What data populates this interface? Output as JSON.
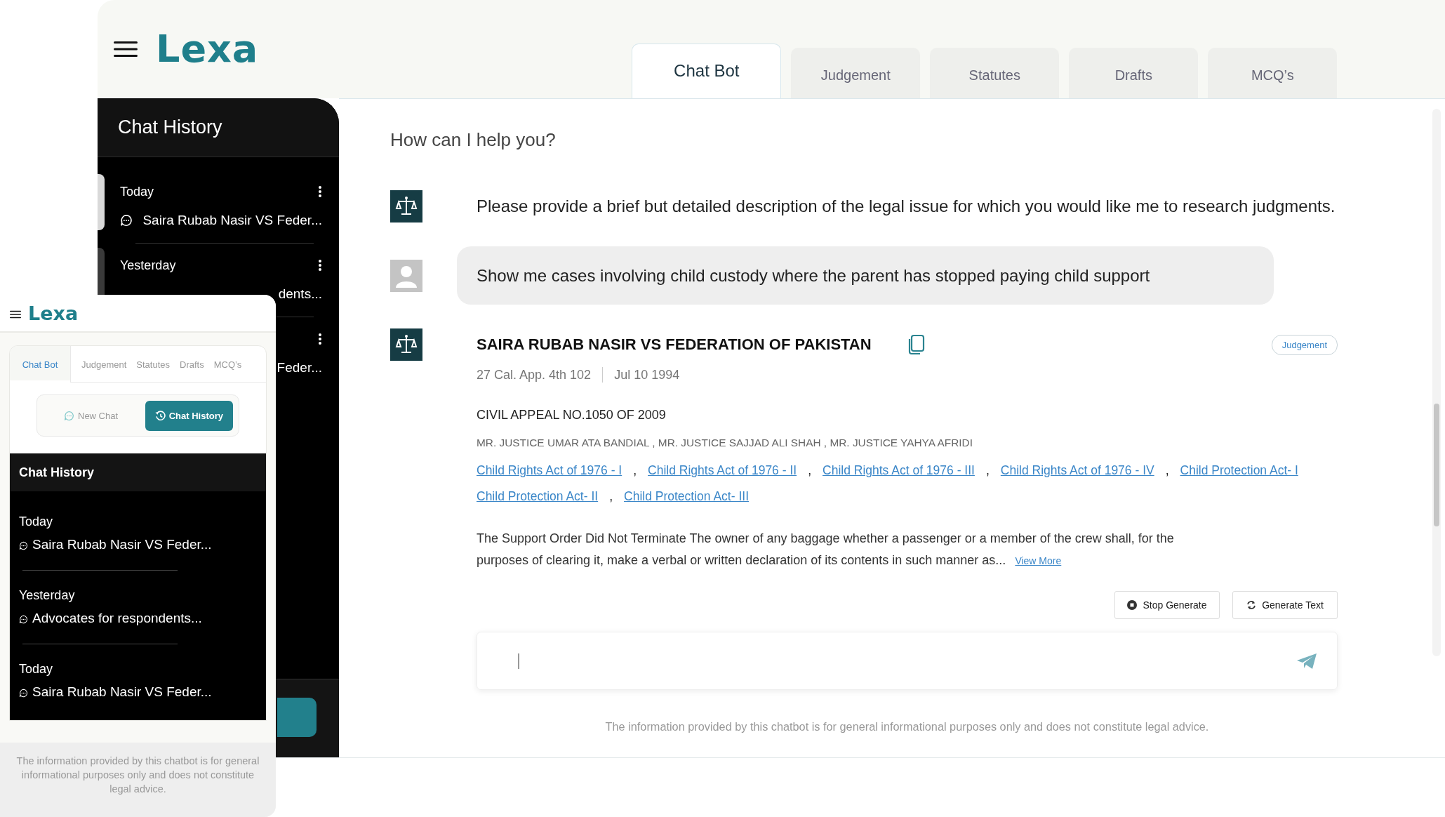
{
  "header": {
    "logo": "Lexa"
  },
  "tabs": [
    {
      "label": "Chat Bot",
      "selected": true
    },
    {
      "label": "Judgement",
      "selected": false
    },
    {
      "label": "Statutes",
      "selected": false
    },
    {
      "label": "Drafts",
      "selected": false
    },
    {
      "label": "MCQ’s",
      "selected": false
    }
  ],
  "sidebar": {
    "title": "Chat History",
    "items": [
      {
        "date": "Today",
        "title": "Saira Rubab Nasir VS Feder...",
        "icon": true,
        "selected": true
      },
      {
        "date": "Yesterday",
        "title": "dents...",
        "icon": false,
        "selected": false
      },
      {
        "title": "Feder...",
        "icon": false
      }
    ]
  },
  "chat": {
    "prompt": "How can I help you?",
    "messages": [
      {
        "kind": "bot",
        "text": "Please provide a brief but detailed description of the legal issue for which you would like me to research judgments."
      },
      {
        "kind": "user",
        "text": "Show me cases involving child custody where the parent has stopped paying child support"
      },
      {
        "kind": "result",
        "title": "SAIRA RUBAB NASIR VS FEDERATION OF PAKISTAN",
        "badge": "Judgement",
        "citation": "27 Cal. App. 4th 102",
        "date": "Jul 10 1994",
        "appeal": "CIVIL APPEAL NO.1050 OF 2009",
        "judges": "MR. JUSTICE UMAR ATA BANDIAL , MR. JUSTICE SAJJAD ALI SHAH , MR. JUSTICE YAHYA AFRIDI",
        "links": [
          {
            "label": "Child Rights Act of 1976 - I",
            "sep": ","
          },
          {
            "label": "Child Rights Act of 1976 - II",
            "sep": ","
          },
          {
            "label": "Child Rights Act of 1976 - III",
            "sep": ","
          },
          {
            "label": "Child Rights Act of 1976 - IV",
            "sep": ","
          },
          {
            "label": "Child Protection Act- I"
          },
          {
            "label": "Child Protection Act- II",
            "sep": ","
          },
          {
            "label": "Child Protection Act- III"
          }
        ],
        "summary": "The Support Order Did Not Terminate The owner of any baggage whether a passenger or a member of the crew shall, for the purposes of clearing it, make a verbal or written declaration of its contents in such manner as...",
        "more": "View More"
      }
    ]
  },
  "actions": [
    {
      "kind": "stop",
      "label": "Stop Generate"
    },
    {
      "kind": "regenerate",
      "label": "Generate Text"
    }
  ],
  "disclaimer": "The information provided by this chatbot is for general informational purposes only and does not constitute legal advice.",
  "mobile": {
    "logo": "Lexa",
    "tabs": [
      {
        "label": "Chat Bot",
        "selected": true
      },
      {
        "label": "Judgement",
        "selected": false
      },
      {
        "label": "Statutes",
        "selected": false
      },
      {
        "label": "Drafts",
        "selected": false
      },
      {
        "label": "MCQ’s",
        "selected": false
      }
    ],
    "segments": [
      {
        "kind": "new",
        "label": "New Chat",
        "selected": false
      },
      {
        "kind": "history",
        "label": "Chat History",
        "selected": true
      }
    ],
    "history": {
      "title": "Chat History",
      "items": [
        {
          "date": "Today",
          "title": "Saira Rubab Nasir VS Feder..."
        },
        {
          "date": "Yesterday",
          "title": "Advocates for respondents..."
        },
        {
          "date": "Today",
          "title": "Saira Rubab Nasir VS Feder..."
        }
      ]
    },
    "disclaimer": "The information provided by this chatbot is for general informational purposes only and does not constitute legal advice."
  }
}
